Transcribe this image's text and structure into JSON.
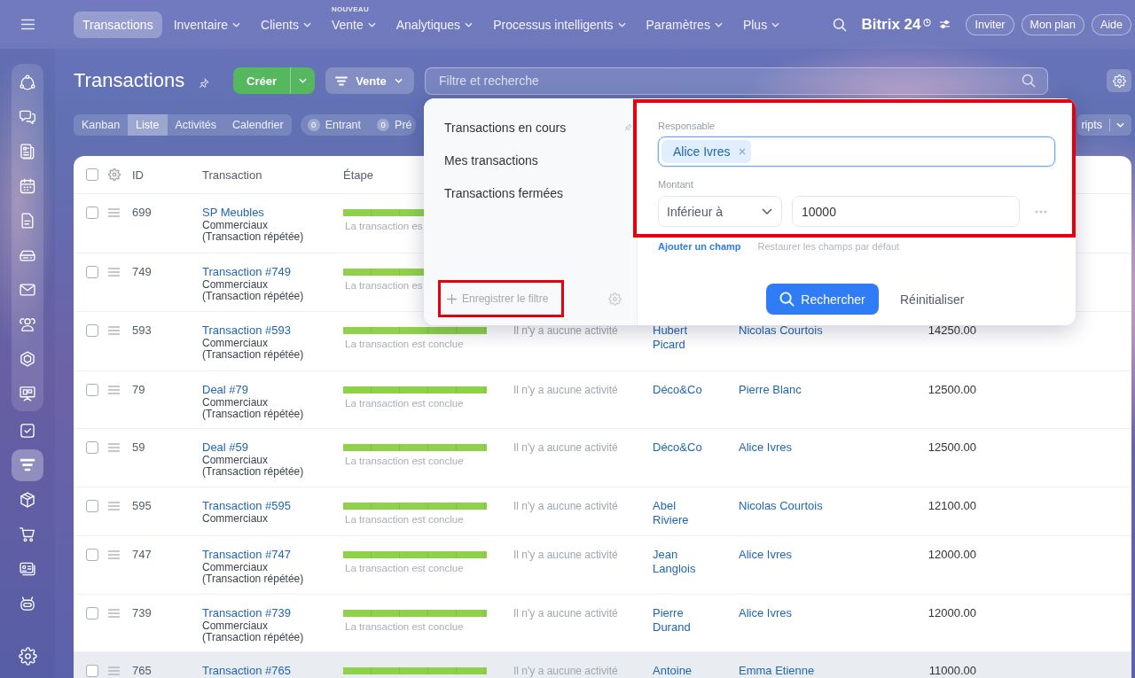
{
  "top_nav": {
    "items": [
      {
        "label": "Transactions",
        "selected": true,
        "has_menu": false
      },
      {
        "label": "Inventaire",
        "selected": false,
        "has_menu": true
      },
      {
        "label": "Clients",
        "selected": false,
        "has_menu": true
      },
      {
        "label": "Vente",
        "selected": false,
        "has_menu": true,
        "badge": "NOUVEAU"
      },
      {
        "label": "Analytiques",
        "selected": false,
        "has_menu": true
      },
      {
        "label": "Processus intelligents",
        "selected": false,
        "has_menu": true
      },
      {
        "label": "Paramètres",
        "selected": false,
        "has_menu": true
      },
      {
        "label": "Plus",
        "selected": false,
        "has_menu": true
      }
    ],
    "brand": "Bitrix 24",
    "buttons": [
      "Inviter",
      "Mon plan",
      "Aide"
    ]
  },
  "sidebar": {
    "panel_items": [
      {
        "selected": false
      },
      {
        "selected": false
      },
      {
        "selected": false
      },
      {
        "selected": false
      },
      {
        "selected": false
      },
      {
        "selected": false
      },
      {
        "selected": false
      },
      {
        "selected": false
      },
      {
        "selected": false
      },
      {
        "selected": false
      }
    ],
    "items": [
      {
        "selected": false
      },
      {
        "selected": true
      },
      {
        "selected": false
      },
      {
        "selected": false
      },
      {
        "selected": false
      },
      {
        "selected": false
      }
    ]
  },
  "header": {
    "title": "Transactions",
    "create_button": "Créer",
    "category_button": "Vente",
    "search": {
      "placeholder": "Filtre et recherche"
    }
  },
  "view_tabs": [
    {
      "label": "Kanban",
      "selected": false
    },
    {
      "label": "Liste",
      "selected": true
    },
    {
      "label": "Activités",
      "selected": false
    },
    {
      "label": "Calendrier",
      "selected": false
    }
  ],
  "counters": [
    {
      "count": "0",
      "label": "Entrant"
    },
    {
      "count": "0",
      "label": "Pré"
    }
  ],
  "toolbar_button": {
    "label": "ripts"
  },
  "table": {
    "all_checked": false,
    "columns": [
      "ID",
      "Transaction",
      "Étape"
    ],
    "rows": [
      {
        "checked": false,
        "hovered": false,
        "id": "699",
        "title": "SP Meubles",
        "lines": [
          "Commerciaux",
          "(Transaction répétée)"
        ],
        "stage": {
          "level": 1,
          "label": "La transaction es"
        }
      },
      {
        "checked": false,
        "hovered": false,
        "id": "749",
        "title": "Transaction #749",
        "lines": [
          "Commerciaux",
          "(Transaction répétée)"
        ],
        "stage": {
          "level": 1,
          "label": "La transaction es"
        }
      },
      {
        "checked": false,
        "hovered": false,
        "id": "593",
        "title": "Transaction #593",
        "lines": [
          "Commerciaux",
          "(Transaction répétée)"
        ],
        "stage": {
          "level": 1,
          "label": "La transaction est conclue"
        },
        "activity": "Il n'y a aucune activité",
        "client": "Hubert Picard",
        "responsible": "Nicolas Courtois",
        "amount": "14250.00"
      },
      {
        "checked": false,
        "hovered": false,
        "id": "79",
        "title": "Deal #79",
        "lines": [
          "Commerciaux",
          "(Transaction répétée)"
        ],
        "stage": {
          "level": 1,
          "label": "La transaction est conclue"
        },
        "activity": "Il n'y a aucune activité",
        "client": "Déco&Co",
        "responsible": "Pierre Blanc",
        "amount": "12500.00"
      },
      {
        "checked": false,
        "hovered": false,
        "id": "59",
        "title": "Deal #59",
        "lines": [
          "Commerciaux",
          "(Transaction répétée)"
        ],
        "stage": {
          "level": 1,
          "label": "La transaction est conclue"
        },
        "activity": "Il n'y a aucune activité",
        "client": "Déco&Co",
        "responsible": "Alice Ivres",
        "amount": "12500.00"
      },
      {
        "checked": false,
        "hovered": false,
        "id": "595",
        "title": "Transaction #595",
        "lines": [
          "Commerciaux"
        ],
        "stage": {
          "level": 1,
          "label": "La transaction est conclue"
        },
        "activity": "Il n'y a aucune activité",
        "client": "Abel Riviere",
        "responsible": "Nicolas Courtois",
        "amount": "12100.00"
      },
      {
        "checked": false,
        "hovered": false,
        "id": "747",
        "title": "Transaction #747",
        "lines": [
          "Commerciaux",
          "(Transaction répétée)"
        ],
        "stage": {
          "level": 1,
          "label": "La transaction est conclue"
        },
        "activity": "Il n'y a aucune activité",
        "client": "Jean Langlois",
        "responsible": "Alice Ivres",
        "amount": "12000.00"
      },
      {
        "checked": false,
        "hovered": false,
        "id": "739",
        "title": "Transaction #739",
        "lines": [
          "Commerciaux",
          "(Transaction répétée)"
        ],
        "stage": {
          "level": 1,
          "label": "La transaction est conclue"
        },
        "activity": "Il n'y a aucune activité",
        "client": "Pierre Durand",
        "responsible": "Alice Ivres",
        "amount": "12000.00"
      },
      {
        "checked": false,
        "hovered": true,
        "id": "765",
        "title": "Transaction #765",
        "stage": {
          "level": 1
        },
        "activity": "Il n'y a aucune activité",
        "client": "Antoine",
        "responsible": "Emma Etienne",
        "amount": "11000.00"
      }
    ]
  },
  "filter_popup": {
    "presets": [
      {
        "label": "Transactions en cours",
        "pinned": true
      },
      {
        "label": "Mes transactions",
        "pinned": false
      },
      {
        "label": "Transactions fermées",
        "pinned": false
      }
    ],
    "save_filter": {
      "label": "Enregistrer le filtre",
      "highlighted": true
    },
    "fields_highlighted": true,
    "fields": [
      {
        "kind": "tags",
        "label": "Responsable",
        "focused": true,
        "tags": [
          "Alice Ivres"
        ]
      },
      {
        "kind": "number",
        "label": "Montant",
        "operator": "Inférieur à",
        "value": "10000"
      }
    ],
    "add_field": "Ajouter un champ",
    "restore_fields": "Restaurer les champs par défaut",
    "search_button": "Rechercher",
    "reset_button": "Réinitialiser"
  }
}
